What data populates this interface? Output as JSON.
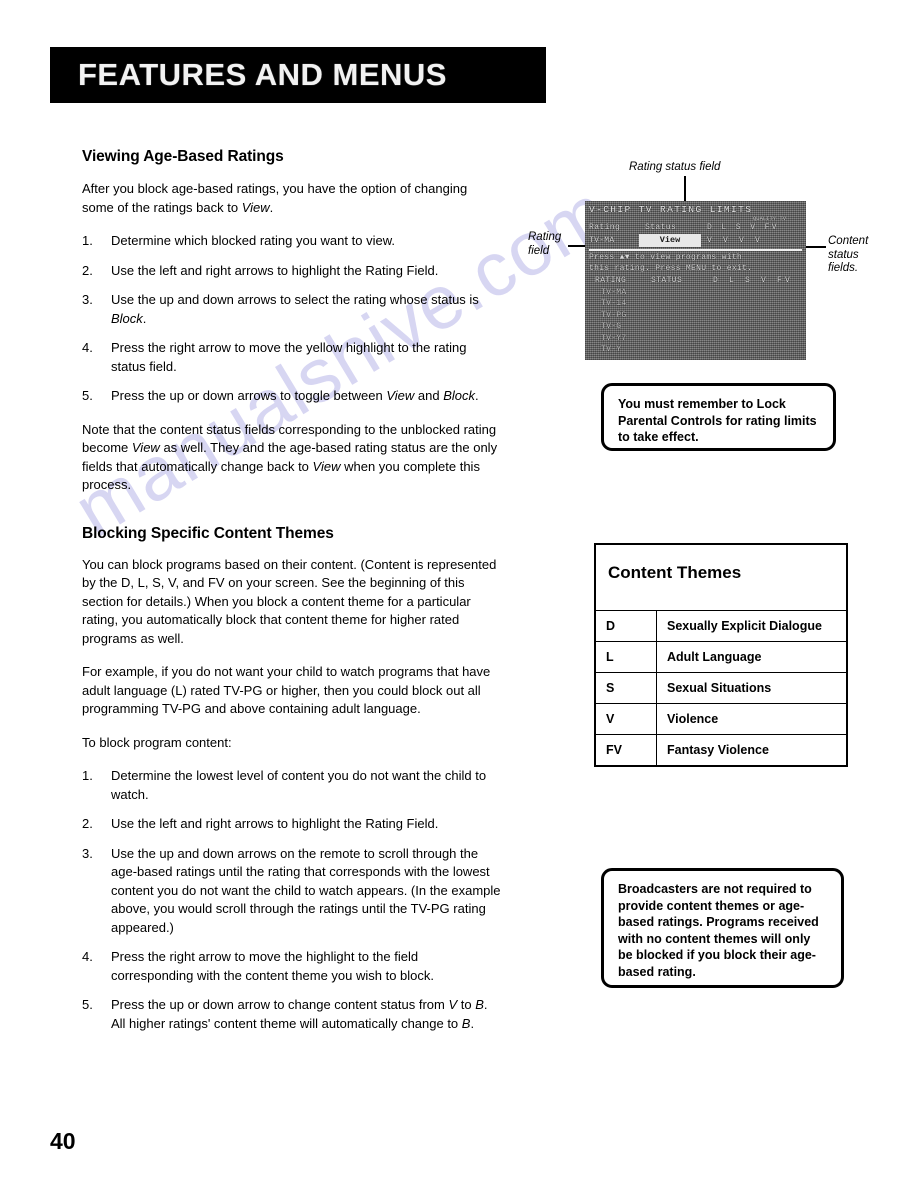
{
  "banner": {
    "title": "FEATURES AND MENUS"
  },
  "page_number": "40",
  "watermark": {
    "text": "manualshive.com"
  },
  "left": {
    "section1": {
      "heading": "Viewing Age-Based Ratings",
      "intro_a": "After you block age-based ratings, you have the option of changing some of the ratings back to ",
      "intro_a_em": "View",
      "intro_a_end": ".",
      "steps": [
        {
          "num": "1.",
          "text": "Determine which blocked rating you want to view."
        },
        {
          "num": "2.",
          "text": "Use the left and right arrows to highlight the Rating Field."
        },
        {
          "num": "3.",
          "text": "Use the up and down arrows to select the rating whose status is ",
          "em": "Block",
          "tail": "."
        },
        {
          "num": "4.",
          "text": "Press the right arrow to move the yellow highlight to the rating status field."
        },
        {
          "num": "5.",
          "text": "Press the up or down arrows to toggle between ",
          "em": "View",
          "tail": " and ",
          "em2": "Block",
          "tail2": "."
        }
      ],
      "note_a": "Note that the content status fields corresponding to the unblocked rating become ",
      "note_em1": "View",
      "note_b": " as well. They and the age-based rating status are the only fields that automatically change back to ",
      "note_em2": "View",
      "note_c": " when you complete this process."
    },
    "section2": {
      "heading": "Blocking Specific Content Themes",
      "para1": "You can block programs based on their content. (Content is represented by the D, L, S, V, and FV on your screen. See the beginning of this section for details.) When you block a content theme for a particular rating, you automatically block that content theme for higher rated programs as well.",
      "para2": "For example, if you do not want your child to watch programs that have adult language (L) rated TV-PG or higher, then you could block out all programming TV-PG and above containing adult language.",
      "para3": "To block program content:",
      "steps": [
        {
          "num": "1.",
          "text": "Determine the lowest level of content you do not want the child to watch."
        },
        {
          "num": "2.",
          "text": "Use the left and right arrows to highlight the Rating Field."
        },
        {
          "num": "3.",
          "text": "Use the up and down arrows on the remote to scroll through the age-based ratings until the rating that corresponds with the lowest content you do not want the child to watch appears.  (In the example above, you would scroll through the ratings until the TV-PG rating appeared.)"
        },
        {
          "num": "4.",
          "text": "Press the right arrow to move the highlight to the field corresponding with the content theme you wish to block."
        },
        {
          "num": "5.",
          "text": "Press the up or down arrow to change content status from ",
          "em": "V",
          "tail": " to ",
          "em2": "B",
          "tail2": ". All higher ratings' content theme will automatically change to ",
          "em3": "B",
          "tail3": "."
        }
      ]
    }
  },
  "right": {
    "callouts": {
      "rating_status_field": "Rating status field",
      "rating_field": "Rating\nfield",
      "rating_field_l1": "Rating",
      "rating_field_l2": "field",
      "content_status_fields_l1": "Content",
      "content_status_fields_l2": "status",
      "content_status_fields_l3": "fields."
    },
    "tv_screen": {
      "title": "V-CHIP TV RATING LIMITS",
      "subtitle": "QUALITY TV",
      "header_rating": "Rating",
      "header_status": "Status",
      "header_flags": "D L S V FV",
      "active_rating": "TV-MA",
      "active_status": "View",
      "active_flags": "V V V V",
      "note_line1": "Press ▲▼ to view programs with",
      "note_line2": "this rating. Press MENU to exit.",
      "list_header_rating": "RATING",
      "list_header_status": "STATUS",
      "list_header_flags": "D L S V FV",
      "ratings": [
        "TV-MA",
        "TV-14",
        "TV-PG",
        "TV-G",
        "TV-Y7",
        "TV-Y"
      ]
    },
    "note_box_1": "You must remember to Lock Parental Controls for rating limits to take effect.",
    "note_box_2": "Broadcasters are not required to provide content themes or age-based ratings. Programs received with no content themes will only be blocked if you block their age-based rating.",
    "themes_table": {
      "title": "Content Themes",
      "rows": [
        {
          "code": "D",
          "desc": "Sexually Explicit Dialogue"
        },
        {
          "code": "L",
          "desc": "Adult Language"
        },
        {
          "code": "S",
          "desc": "Sexual Situations"
        },
        {
          "code": "V",
          "desc": "Violence"
        },
        {
          "code": "FV",
          "desc": "Fantasy Violence"
        }
      ]
    }
  }
}
